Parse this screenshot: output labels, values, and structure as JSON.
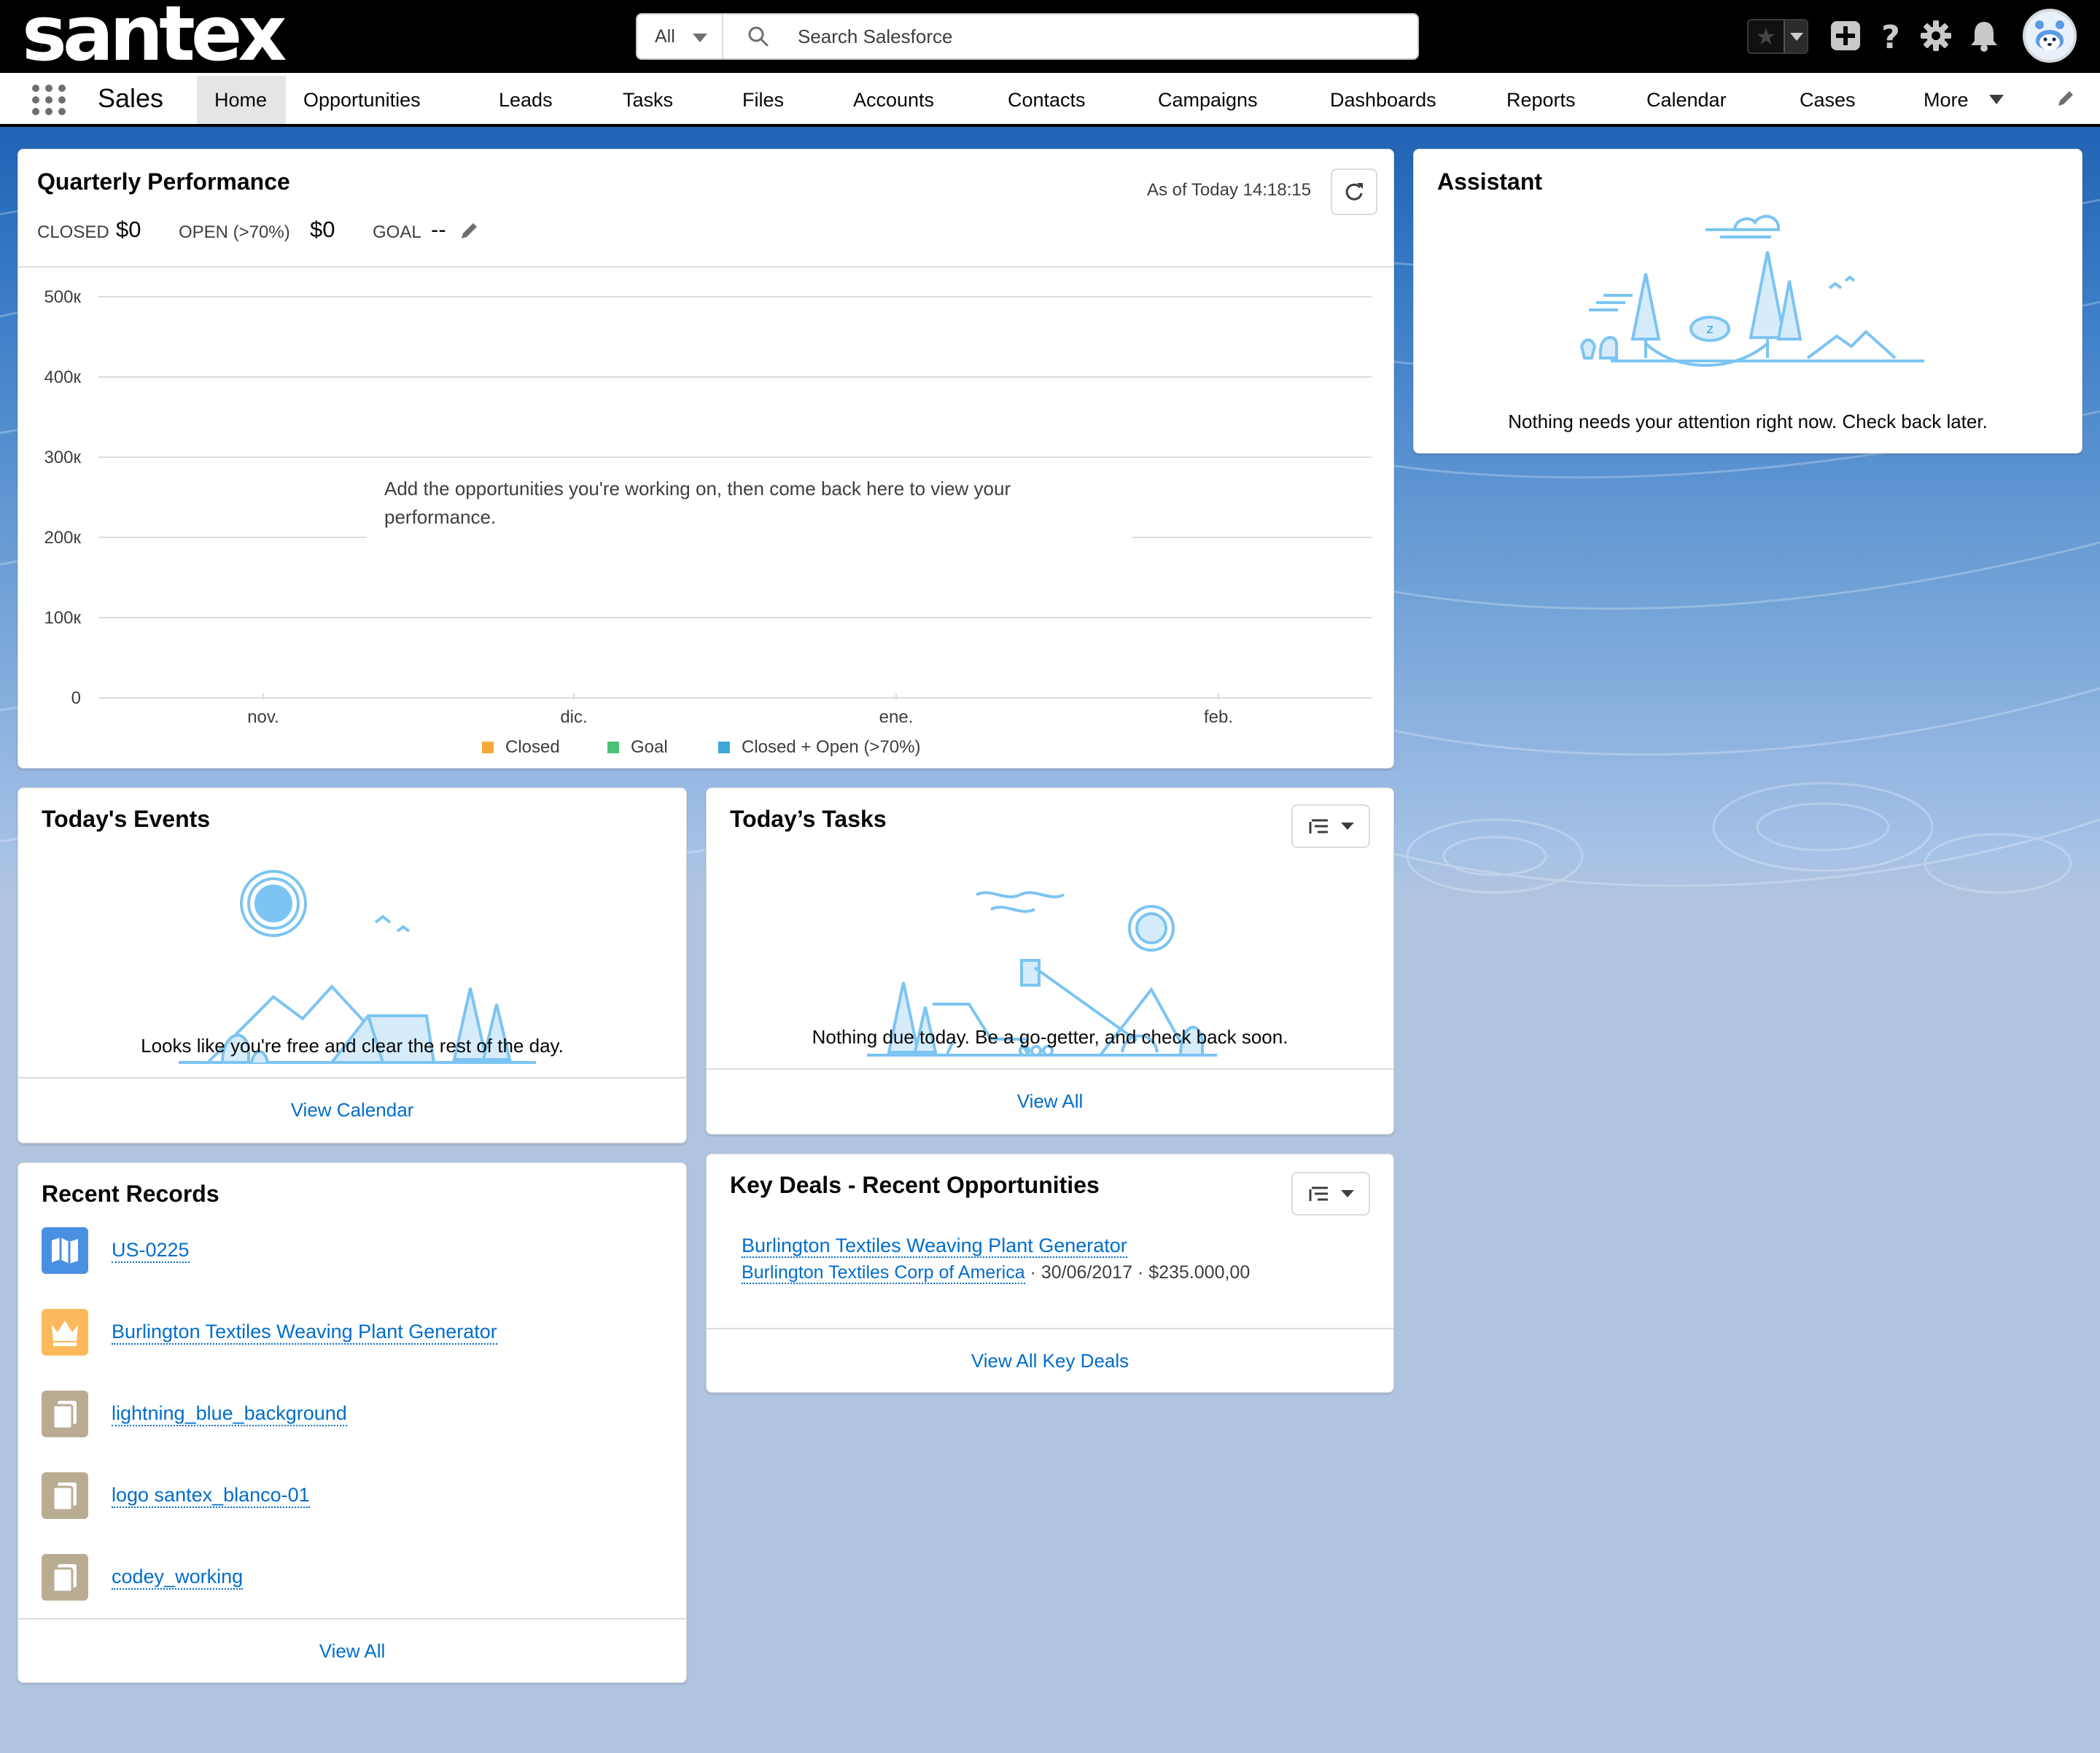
{
  "header": {
    "logo_text": "santex",
    "search": {
      "scope": "All",
      "placeholder": "Search Salesforce"
    },
    "icons": [
      "favorites-star-icon",
      "add-icon",
      "help-icon",
      "setup-gear-icon",
      "notifications-bell-icon",
      "user-avatar"
    ]
  },
  "nav": {
    "app_name": "Sales",
    "items": [
      {
        "label": "Home",
        "active": true
      },
      {
        "label": "Opportunities"
      },
      {
        "label": "Leads"
      },
      {
        "label": "Tasks"
      },
      {
        "label": "Files"
      },
      {
        "label": "Accounts"
      },
      {
        "label": "Contacts"
      },
      {
        "label": "Campaigns"
      },
      {
        "label": "Dashboards"
      },
      {
        "label": "Reports"
      },
      {
        "label": "Calendar"
      },
      {
        "label": "Cases"
      },
      {
        "label": "More"
      }
    ]
  },
  "quarterly": {
    "title": "Quarterly Performance",
    "as_of": "As of Today 14:18:15",
    "closed_label": "CLOSED",
    "closed_value": "$0",
    "open_label": "OPEN (>70%)",
    "open_value": "$0",
    "goal_label": "GOAL",
    "goal_value": "--",
    "empty_message": "Add the opportunities you're working on, then come back here to view your performance."
  },
  "chart_data": {
    "type": "line",
    "categories": [
      "nov.",
      "dic.",
      "ene.",
      "feb."
    ],
    "y_ticks": [
      "0",
      "100к",
      "200к",
      "300к",
      "400к",
      "500к"
    ],
    "ylim": [
      0,
      500000
    ],
    "series": [
      {
        "name": "Closed",
        "color": "#f4a93a",
        "values": []
      },
      {
        "name": "Goal",
        "color": "#4bc076",
        "values": []
      },
      {
        "name": "Closed + Open (>70%)",
        "color": "#3ba7d9",
        "values": []
      }
    ],
    "grid": true,
    "legend": "bottom"
  },
  "assistant": {
    "title": "Assistant",
    "empty_message": "Nothing needs your attention right now. Check back later."
  },
  "events": {
    "title": "Today's Events",
    "empty_message": "Looks like you're free and clear the rest of the day.",
    "footer_link": "View Calendar"
  },
  "tasks": {
    "title": "Today’s Tasks",
    "empty_message": "Nothing due today. Be a go-getter, and check back soon.",
    "footer_link": "View All"
  },
  "recent": {
    "title": "Recent Records",
    "items": [
      {
        "label": "US-0225",
        "icon": "user-story-icon",
        "color": "#4a90e2"
      },
      {
        "label": "Burlington Textiles Weaving Plant Generator",
        "icon": "opportunity-crown-icon",
        "color": "#fcb95b"
      },
      {
        "label": "lightning_blue_background",
        "icon": "file-icon",
        "color": "#baac93"
      },
      {
        "label": "logo santex_blanco-01",
        "icon": "file-icon",
        "color": "#baac93"
      },
      {
        "label": "codey_working",
        "icon": "file-icon",
        "color": "#baac93"
      }
    ],
    "footer_link": "View All"
  },
  "deals": {
    "title": "Key Deals - Recent Opportunities",
    "deal_name": "Burlington Textiles Weaving Plant Generator",
    "account": "Burlington Textiles Corp of America",
    "close_date": "30/06/2017",
    "amount": "$235.000,00",
    "footer_link": "View All Key Deals"
  }
}
